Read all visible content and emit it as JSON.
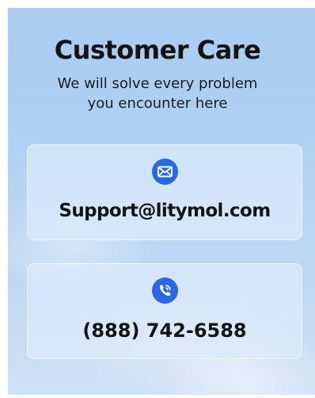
{
  "header": {
    "title": "Customer Care",
    "subtitle_line1": "We will solve every problem",
    "subtitle_line2": "you encounter here"
  },
  "contacts": {
    "email": {
      "icon": "envelope-icon",
      "value": "Support@litymol.com"
    },
    "phone": {
      "icon": "phone-call-icon",
      "value": "(888) 742-6588"
    }
  },
  "colors": {
    "accent": "#2a67e3",
    "text": "#141414"
  }
}
